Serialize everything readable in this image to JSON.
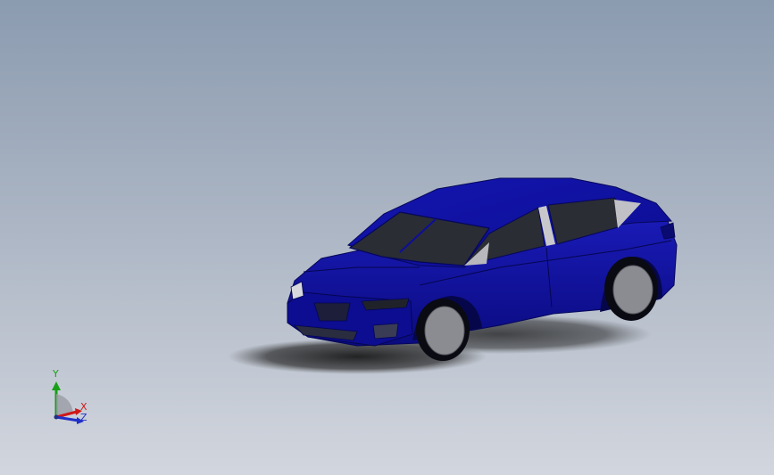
{
  "viewport": {
    "background_top": "#8b9bb0",
    "background_bottom": "#d2d6de"
  },
  "model": {
    "body_color": "#0e0f9e",
    "glass_color": "#2a2d33",
    "wheel_color": "#8a8c92"
  },
  "triad": {
    "y_label": "Y",
    "x_label": "X",
    "z_label": "Z",
    "y_color": "#18a018",
    "x_color": "#d01818",
    "z_color": "#2030c8"
  }
}
